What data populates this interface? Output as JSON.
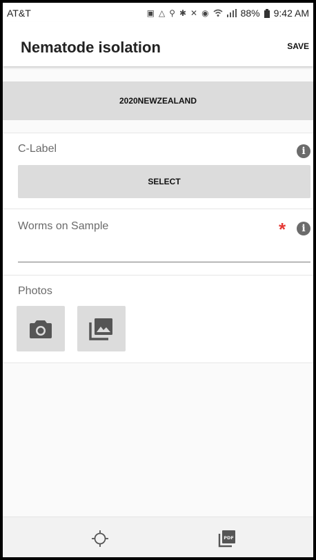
{
  "status_bar": {
    "carrier": "AT&T",
    "battery": "88%",
    "time": "9:42 AM",
    "icons": [
      "image-icon",
      "drive-icon",
      "location-icon",
      "bluetooth-icon",
      "mute-icon",
      "alarm-icon",
      "wifi-icon",
      "signal-icon",
      "battery-icon"
    ]
  },
  "header": {
    "title": "Nematode isolation",
    "save_label": "SAVE"
  },
  "project": {
    "name": "2020NEWZEALAND"
  },
  "c_label": {
    "label": "C-Label",
    "select_label": "SELECT",
    "info_icon": "info-icon"
  },
  "worms": {
    "label": "Worms on Sample",
    "required_mark": "*",
    "value": "",
    "info_icon": "info-icon"
  },
  "photos": {
    "label": "Photos",
    "buttons": [
      "camera-icon",
      "gallery-icon"
    ]
  },
  "bottom_bar": {
    "buttons": [
      "gps-target-icon",
      "pdf-icon"
    ]
  },
  "colors": {
    "required": "#e53935",
    "button_gray": "#dcdcdc",
    "icon_gray": "#6b6b6b"
  }
}
